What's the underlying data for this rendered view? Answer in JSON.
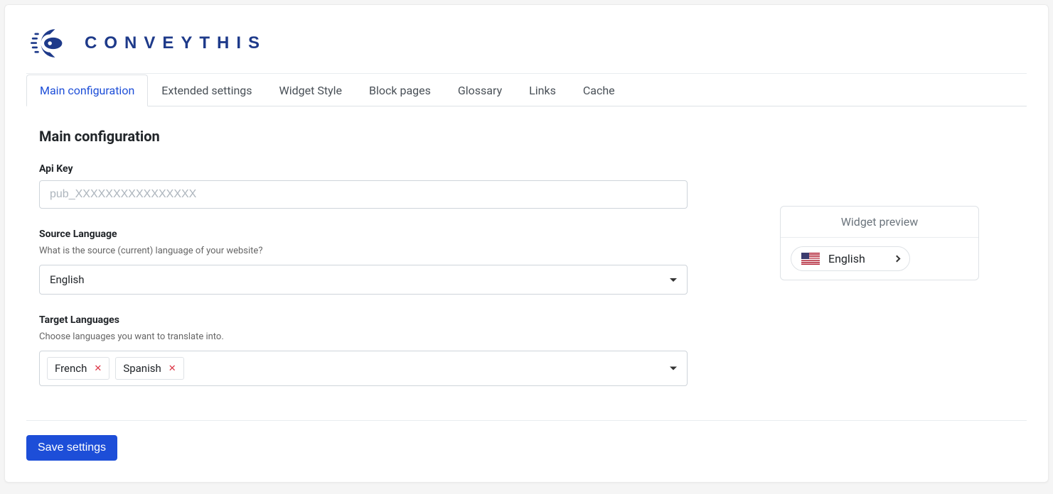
{
  "brand": {
    "name": "CONVEYTHIS"
  },
  "tabs": [
    {
      "label": "Main configuration",
      "active": true
    },
    {
      "label": "Extended settings",
      "active": false
    },
    {
      "label": "Widget Style",
      "active": false
    },
    {
      "label": "Block pages",
      "active": false
    },
    {
      "label": "Glossary",
      "active": false
    },
    {
      "label": "Links",
      "active": false
    },
    {
      "label": "Cache",
      "active": false
    }
  ],
  "section": {
    "title": "Main configuration"
  },
  "api_key": {
    "label": "Api Key",
    "placeholder": "pub_XXXXXXXXXXXXXXXX",
    "value": ""
  },
  "source_language": {
    "label": "Source Language",
    "hint": "What is the source (current) language of your website?",
    "value": "English"
  },
  "target_languages": {
    "label": "Target Languages",
    "hint": "Choose languages you want to translate into.",
    "selected": [
      "French",
      "Spanish"
    ]
  },
  "widget_preview": {
    "title": "Widget preview",
    "current_language": "English"
  },
  "actions": {
    "save": "Save settings"
  }
}
